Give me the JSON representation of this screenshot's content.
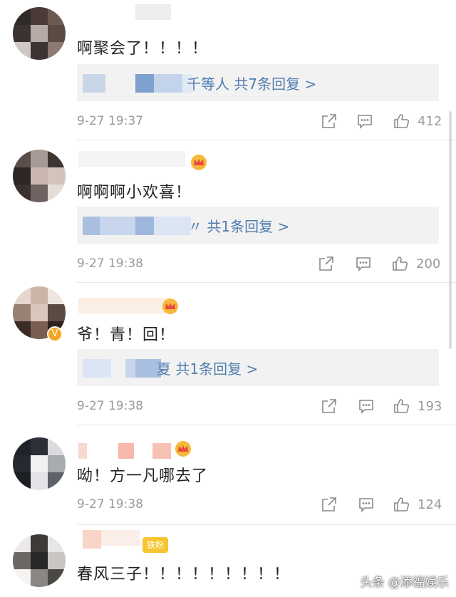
{
  "comments": [
    {
      "text": "啊聚会了！！！！",
      "reply_link": "千等人 共7条回复 >",
      "time": "9-27 19:37",
      "likes": "412"
    },
    {
      "text": "啊啊啊小欢喜！",
      "reply_link": "〃 共1条回复 >",
      "time": "9-27 19:38",
      "likes": "200"
    },
    {
      "text": "爷！青！回！",
      "reply_link": "夏 共1条回复 >",
      "time": "9-27 19:38",
      "likes": "193"
    },
    {
      "text": "呦！方一凡哪去了",
      "time": "9-27 19:38",
      "likes": "124"
    },
    {
      "text": "春风三子！！！！！！！！！",
      "fan_badge": "铁粉"
    }
  ],
  "watermark": "头条 @添福娱乐",
  "icons": {
    "share": "share-icon",
    "comment": "comment-icon",
    "like": "thumbs-up-icon",
    "crown": "crown-icon",
    "verified": "verified-v-icon"
  },
  "colors": {
    "link": "#507daf",
    "meta": "#9a9a9a",
    "reply_bg": "#f2f2f2",
    "verified": "#f5a623"
  }
}
